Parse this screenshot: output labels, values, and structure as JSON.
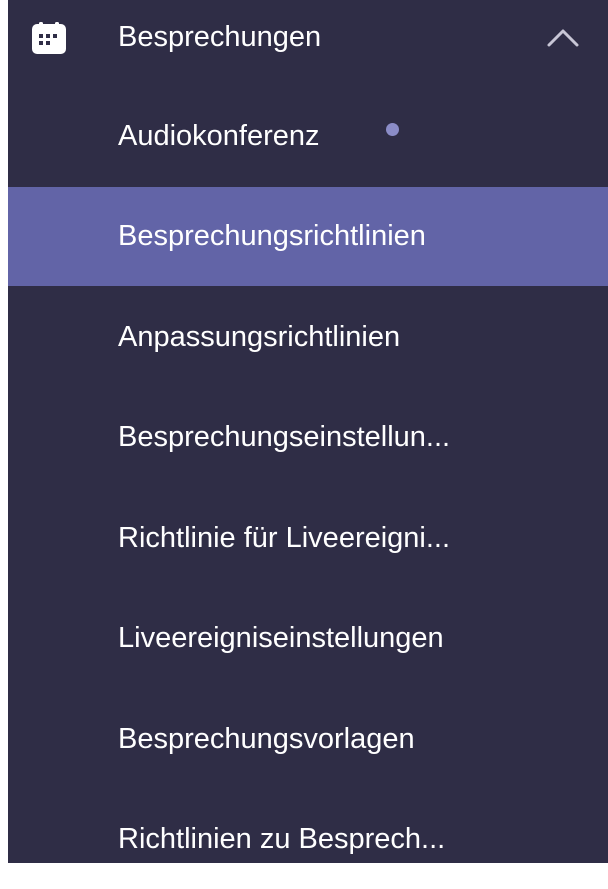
{
  "section": {
    "label": "Besprechungen",
    "icon": "calendar-icon",
    "expanded_icon": "chevron-up-icon"
  },
  "items": [
    {
      "label": "Audiokonferenz",
      "has_badge": true
    },
    {
      "label": "Besprechungsrichtlinien",
      "selected": true
    },
    {
      "label": "Anpassungsrichtlinien"
    },
    {
      "label": "Besprechungseinstellun..."
    },
    {
      "label": "Richtlinie für Liveereigni..."
    },
    {
      "label": "Liveereigniseinstellungen"
    },
    {
      "label": "Besprechungsvorlagen"
    },
    {
      "label": "Richtlinien zu Besprech..."
    }
  ],
  "colors": {
    "panel_background": "#2f2d46",
    "selected_background": "#6264a7",
    "text": "#ffffff",
    "badge": "#8b8cc7"
  }
}
